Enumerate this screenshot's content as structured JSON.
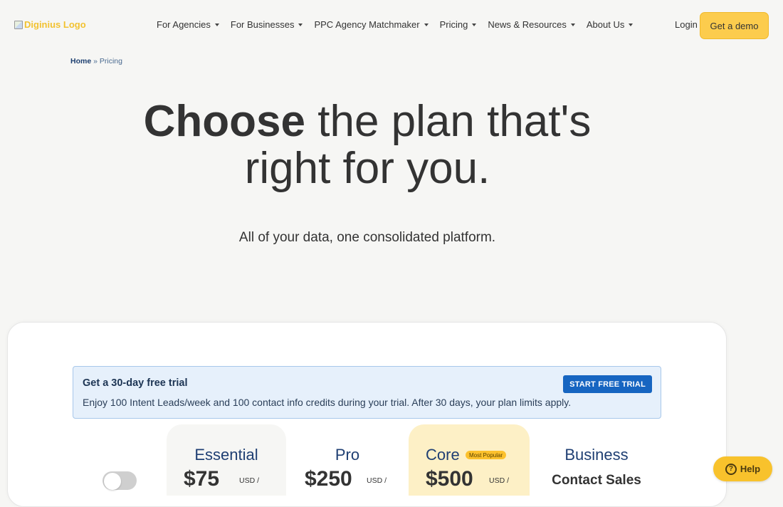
{
  "nav": {
    "logo_text": "Diginius Logo",
    "items": [
      {
        "label": "For Agencies"
      },
      {
        "label": "For Businesses"
      },
      {
        "label": "PPC Agency Matchmaker"
      },
      {
        "label": "Pricing"
      },
      {
        "label": "News & Resources"
      },
      {
        "label": "About Us"
      }
    ],
    "login_label": "Login",
    "demo_label": "Get a demo"
  },
  "breadcrumb": {
    "home": "Home",
    "separator": "»",
    "current": "Pricing"
  },
  "hero": {
    "bold": "Choose",
    "line1_rest": "the plan that's",
    "line2": "right for you.",
    "subtitle": "All of your data, one consolidated platform."
  },
  "trial": {
    "title": "Get a 30-day free trial",
    "description": "Enjoy 100 Intent Leads/week and 100 contact info credits during your trial. After 30 days, your plan limits apply.",
    "button_label": "START FREE TRIAL"
  },
  "plans": [
    {
      "name": "Essential",
      "price": "$75",
      "unit": "USD /"
    },
    {
      "name": "Pro",
      "price": "$250",
      "unit": "USD /"
    },
    {
      "name": "Core",
      "badge": "Most Popular",
      "price": "$500",
      "unit": "USD /"
    },
    {
      "name": "Business",
      "contact": "Contact Sales"
    }
  ],
  "help": {
    "label": "Help",
    "icon": "?"
  },
  "colors": {
    "accent": "#fccc4d",
    "primary_blue": "#1665c1",
    "plan_title": "#1f3f73"
  }
}
